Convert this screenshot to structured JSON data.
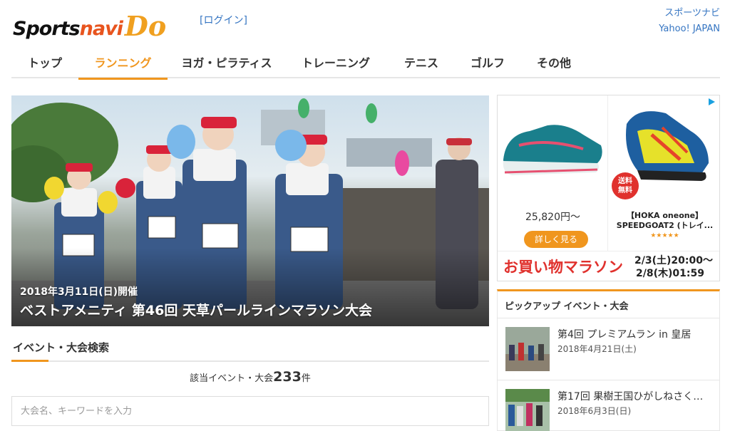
{
  "header": {
    "logo": "Sportsnavi Do",
    "login": "[ログイン]",
    "links": [
      "スポーツナビ",
      "Yahoo! JAPAN"
    ]
  },
  "nav": [
    {
      "label": "トップ",
      "active": false
    },
    {
      "label": "ランニング",
      "active": true
    },
    {
      "label": "ヨガ・ピラティス",
      "active": false
    },
    {
      "label": "トレーニング",
      "active": false
    },
    {
      "label": "テニス",
      "active": false
    },
    {
      "label": "ゴルフ",
      "active": false
    },
    {
      "label": "その他",
      "active": false
    }
  ],
  "hero": {
    "date": "2018年3月11日(日)開催",
    "title": "ベストアメニティ 第46回 天草パールラインマラソン大会"
  },
  "search": {
    "title": "イベント・大会検索",
    "count_prefix": "該当イベント・大会",
    "count_value": "233",
    "count_suffix": "件",
    "placeholder": "大会名、キーワードを入力"
  },
  "ad": {
    "price": "25,820円～",
    "button": "詳しく見る",
    "brand_line1": "【HOKA oneone】",
    "brand_line2": "SPEEDGOAT2 (トレイ...",
    "stars": "★★★★★",
    "badge": "送料無料",
    "banner": "お買い物マラソン",
    "date1": "2/3(土)20:00～",
    "date2": "2/8(木)01:59"
  },
  "pickup": {
    "title": "ピックアップ イベント・大会",
    "items": [
      {
        "name": "第4回 プレミアムラン in 皇居",
        "date": "2018年4月21日(土)"
      },
      {
        "name": "第17回 果樹王国ひがしねさく…",
        "date": "2018年6月3日(日)"
      }
    ]
  },
  "colors": {
    "accent": "#f0961e",
    "link": "#3575c2",
    "brand_navi": "#e8541e",
    "sale_red": "#e0312d"
  }
}
